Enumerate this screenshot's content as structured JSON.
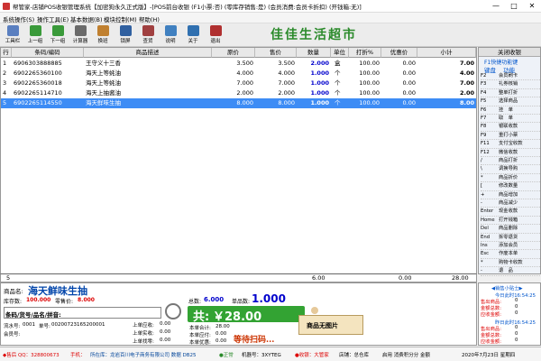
{
  "window": {
    "title": "帮管家-店铺POS收银管理系统【加密狗永久正式版】-[POS前台收银 (F1小票:否) (零库存销售:是) (会员消费:会员卡折扣) (开钱箱:无)]",
    "minimize": "—",
    "maximize": "□",
    "close": "✕"
  },
  "menu": [
    "系统操作(S)",
    "操作工具(E)",
    "基本数据(B)",
    "模块控制(M)",
    "帮助(H)"
  ],
  "toolbar": [
    {
      "label": "工具栏",
      "color": "#5a7fc0"
    },
    {
      "label": "上一组",
      "color": "#3a9a3a"
    },
    {
      "label": "下一组",
      "color": "#3a9a3a"
    },
    {
      "label": "计算器",
      "color": "#6a6a6a"
    },
    {
      "label": "换班",
      "color": "#c08030"
    },
    {
      "label": "锁屏",
      "color": "#3060a0"
    },
    {
      "label": "查货",
      "color": "#a04040"
    },
    {
      "label": "说明",
      "color": "#4080c0"
    },
    {
      "label": "关于",
      "color": "#3070b0"
    },
    {
      "label": "退出",
      "color": "#b03030"
    }
  ],
  "shop_name": "佳佳生活超市",
  "grid": {
    "headers": [
      "行",
      "条码/编码",
      "商品描述",
      "原价",
      "售价",
      "数量",
      "单位",
      "打折%",
      "优惠价",
      "小计"
    ],
    "rows": [
      {
        "no": "1",
        "code": "6906303888885",
        "desc": "王守义十三香",
        "orig": "3.500",
        "price": "3.500",
        "qty": "2.000",
        "unit": "盒",
        "disc": "100.00",
        "promo": "0.00",
        "subtotal": "7.00"
      },
      {
        "no": "2",
        "code": "6902265360100",
        "desc": "海天上等蚝油",
        "orig": "4.000",
        "price": "4.000",
        "qty": "1.000",
        "unit": "个",
        "disc": "100.00",
        "promo": "0.00",
        "subtotal": "4.00"
      },
      {
        "no": "3",
        "code": "6902265360018",
        "desc": "海天上等蚝油",
        "orig": "7.000",
        "price": "7.000",
        "qty": "1.000",
        "unit": "个",
        "disc": "100.00",
        "promo": "0.00",
        "subtotal": "7.00"
      },
      {
        "no": "4",
        "code": "6902265114710",
        "desc": "海天上抽酱油",
        "orig": "2.000",
        "price": "2.000",
        "qty": "1.000",
        "unit": "个",
        "disc": "100.00",
        "promo": "0.00",
        "subtotal": "2.00"
      },
      {
        "no": "5",
        "code": "6902265114550",
        "desc": "海天鲜味生抽",
        "orig": "8.000",
        "price": "8.000",
        "qty": "1.000",
        "unit": "个",
        "disc": "100.00",
        "promo": "0.00",
        "subtotal": "8.00"
      }
    ],
    "footer": {
      "count": "5",
      "qty_total": "6.00",
      "promo_total": "0.00",
      "sum_total": "28.00"
    }
  },
  "rpanel": {
    "title": "关闭收银",
    "subtitle": "F1快捷功能键",
    "tab_keys": "键盘",
    "tab_func": "功能",
    "keys": [
      {
        "k": "F2",
        "n": "会员刷卡"
      },
      {
        "k": "F3",
        "n": "礼券核销"
      },
      {
        "k": "F4",
        "n": "整单打折"
      },
      {
        "k": "F5",
        "n": "选择商品"
      },
      {
        "k": "F6",
        "n": "挂　单"
      },
      {
        "k": "F7",
        "n": "取　单"
      },
      {
        "k": "F8",
        "n": "银联收款"
      },
      {
        "k": "F9",
        "n": "重打小票"
      },
      {
        "k": "F11",
        "n": "支付宝收款"
      },
      {
        "k": "F12",
        "n": "微信收款"
      },
      {
        "k": "/",
        "n": "商品打折"
      },
      {
        "k": "\\",
        "n": "调换导购"
      },
      {
        "k": "*",
        "n": "商品折价"
      },
      {
        "k": "[",
        "n": "修改数量"
      },
      {
        "k": "+",
        "n": "商品增加"
      },
      {
        "k": "-",
        "n": "商品减少"
      },
      {
        "k": "Enter",
        "n": "现金收款"
      },
      {
        "k": "Home",
        "n": "打开钱箱"
      },
      {
        "k": "Del",
        "n": "商品删除"
      },
      {
        "k": "End",
        "n": "拆零退货"
      },
      {
        "k": "Ins",
        "n": "添加会员"
      },
      {
        "k": "Esc",
        "n": "作废本单"
      },
      {
        "k": "*",
        "n": "购物卡收款"
      },
      {
        "k": "-",
        "n": "退　品"
      }
    ]
  },
  "info": {
    "product_label": "商品名:",
    "product_name": "海天鲜味生抽",
    "stock_label": "库存数:",
    "stock_value": "100.000",
    "retail_label": "零售价:",
    "retail_value": "8.000",
    "total_qty_label": "总数:",
    "total_qty": "6.000",
    "unit_count_label": "单品数:",
    "unit_count": "1.000",
    "entry_label": "条码/货号/品名/拼音:",
    "serial_label": "流水号:",
    "serial_value": "0001",
    "order_label": "单号:",
    "order_value": "00200723165200001",
    "member_label": "会员号:",
    "prev_recv_label": "上单应收:",
    "prev_recv": "0.00",
    "prev_paid_label": "上单实收:",
    "prev_paid": "0.00",
    "prev_change_label": "上单找零:",
    "prev_change": "0.00",
    "cur_total_label": "本单合计:",
    "cur_total": "28.00",
    "cur_recv_label": "本单应付:",
    "cur_recv": "0.00",
    "cur_promo_label": "本单优惠:",
    "cur_promo": "0.00",
    "big_total_prefix": "共:",
    "big_total": "￥28.00",
    "no_image": "商品无图片",
    "waiting": "等待扫码..."
  },
  "tips": {
    "title": "◀销售小贴士▶",
    "today_label": "今日此时16:54:25",
    "today_sales_label": "售出商品:",
    "today_sales": "0",
    "today_amount_label": "金额总数:",
    "today_amount": "0",
    "today_recv_label": "应收金额:",
    "today_recv": "0",
    "yest_label": "昨日此时16:54:25",
    "yest_sales_label": "售出商品:",
    "yest_sales": "0",
    "yest_amount_label": "金额总数:",
    "yest_amount": "0",
    "yest_recv_label": "应收金额:",
    "yest_recv": "0"
  },
  "status": {
    "qq": "◆售后 QQ：328800673",
    "phone": "手机：",
    "company": "所在库：龙岩百川电子商务有限公司 数据 DB25",
    "ok": "●正常",
    "machine": "机器号：3XYTEG",
    "cashier": "●收银：大管家",
    "shop": "店铺：总仓库",
    "inventory": "启用 消费积分分 金额",
    "date": "2020年7月23日 星期四"
  }
}
